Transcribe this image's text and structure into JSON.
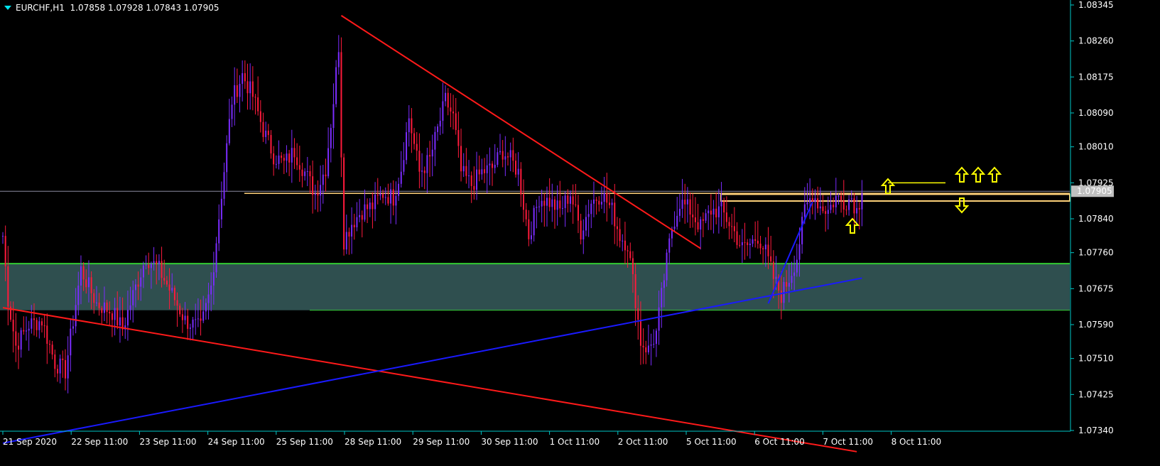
{
  "header": {
    "symbol": "EURCHF,H1",
    "ohlc": "1.07858 1.07928 1.07843 1.07905"
  },
  "colors": {
    "background": "#000000",
    "axis": "#00c8c8",
    "bull_candle": "#7b2cff",
    "bear_candle": "#ff1a3c",
    "trendline_red": "#ff1a1a",
    "trendline_blue": "#1a1aff",
    "support_zone": "#2f4f4f",
    "support_border": "#33cc33",
    "resistance_line": "#ffd27a",
    "arrow": "#ffff00",
    "price_label_bg": "#c0c0c0"
  },
  "chart_data": {
    "type": "candlestick",
    "symbol": "EURCHF",
    "timeframe": "H1",
    "current_price": "1.07905",
    "y_ticks": [
      "1.08345",
      "1.08260",
      "1.08175",
      "1.08090",
      "1.08010",
      "1.07925",
      "1.07840",
      "1.07760",
      "1.07675",
      "1.07590",
      "1.07510",
      "1.07425",
      "1.07340"
    ],
    "x_labels": [
      "21 Sep 2020",
      "22 Sep 11:00",
      "23 Sep 11:00",
      "24 Sep 11:00",
      "25 Sep 11:00",
      "28 Sep 11:00",
      "29 Sep 11:00",
      "30 Sep 11:00",
      "1 Oct 11:00",
      "2 Oct 11:00",
      "5 Oct 11:00",
      "6 Oct 11:00",
      "7 Oct 11:00",
      "8 Oct 11:00"
    ],
    "price_path": [
      [
        0,
        1.078
      ],
      [
        2,
        1.0765
      ],
      [
        5,
        1.0754
      ],
      [
        10,
        1.0759
      ],
      [
        15,
        1.076
      ],
      [
        20,
        1.075
      ],
      [
        24,
        1.0748
      ],
      [
        30,
        1.0772
      ],
      [
        36,
        1.0764
      ],
      [
        42,
        1.0762
      ],
      [
        46,
        1.0758
      ],
      [
        50,
        1.0766
      ],
      [
        55,
        1.0775
      ],
      [
        60,
        1.0772
      ],
      [
        66,
        1.0765
      ],
      [
        70,
        1.076
      ],
      [
        76,
        1.0758
      ],
      [
        80,
        1.0768
      ],
      [
        84,
        1.079
      ],
      [
        88,
        1.0812
      ],
      [
        92,
        1.0818
      ],
      [
        96,
        1.0813
      ],
      [
        100,
        1.0805
      ],
      [
        104,
        1.0799
      ],
      [
        108,
        1.0797
      ],
      [
        112,
        1.08
      ],
      [
        116,
        1.0795
      ],
      [
        120,
        1.079
      ],
      [
        124,
        1.0796
      ],
      [
        127,
        1.0812
      ],
      [
        129,
        1.0825
      ],
      [
        130,
        1.08
      ],
      [
        131,
        1.0779
      ],
      [
        134,
        1.0783
      ],
      [
        138,
        1.0786
      ],
      [
        142,
        1.0787
      ],
      [
        146,
        1.079
      ],
      [
        150,
        1.0789
      ],
      [
        153,
        1.0796
      ],
      [
        156,
        1.0808
      ],
      [
        160,
        1.0795
      ],
      [
        164,
        1.0798
      ],
      [
        167,
        1.0805
      ],
      [
        170,
        1.0812
      ],
      [
        173,
        1.0808
      ],
      [
        176,
        1.0795
      ],
      [
        180,
        1.0792
      ],
      [
        184,
        1.0795
      ],
      [
        188,
        1.0796
      ],
      [
        192,
        1.08
      ],
      [
        195,
        1.0798
      ],
      [
        198,
        1.0795
      ],
      [
        202,
        1.078
      ],
      [
        206,
        1.0789
      ],
      [
        210,
        1.0788
      ],
      [
        214,
        1.0786
      ],
      [
        218,
        1.079
      ],
      [
        222,
        1.0781
      ],
      [
        226,
        1.0788
      ],
      [
        230,
        1.079
      ],
      [
        234,
        1.0786
      ],
      [
        237,
        1.078
      ],
      [
        240,
        1.0778
      ],
      [
        243,
        1.0765
      ],
      [
        245,
        1.0755
      ],
      [
        248,
        1.0753
      ],
      [
        251,
        1.0757
      ],
      [
        254,
        1.077
      ],
      [
        257,
        1.0782
      ],
      [
        260,
        1.0788
      ],
      [
        264,
        1.0786
      ],
      [
        268,
        1.0782
      ],
      [
        272,
        1.0786
      ],
      [
        276,
        1.0786
      ],
      [
        280,
        1.0782
      ],
      [
        284,
        1.0777
      ],
      [
        287,
        1.0778
      ],
      [
        290,
        1.078
      ],
      [
        293,
        1.0776
      ],
      [
        296,
        1.077
      ],
      [
        299,
        1.0766
      ],
      [
        302,
        1.077
      ],
      [
        305,
        1.0775
      ],
      [
        308,
        1.0786
      ],
      [
        311,
        1.079
      ],
      [
        314,
        1.0787
      ],
      [
        317,
        1.0786
      ],
      [
        320,
        1.0789
      ],
      [
        323,
        1.0788
      ],
      [
        326,
        1.0789
      ],
      [
        328,
        1.0786
      ],
      [
        330,
        1.079
      ]
    ]
  },
  "annotations": {
    "red_trendline_a": [
      [
        130,
        1.0832
      ],
      [
        268,
        1.0777
      ]
    ],
    "red_trendline_b": [
      [
        0,
        1.0763
      ],
      [
        328,
        1.0729
      ]
    ],
    "blue_trendline_a": [
      [
        0,
        1.0731
      ],
      [
        330,
        1.077
      ]
    ],
    "blue_trendline_b": [
      [
        294,
        1.0764
      ],
      [
        311,
        1.0788
      ]
    ],
    "support_zone": [
      1.07624,
      1.07734
    ],
    "resistance_band": [
      1.07882,
      1.07898
    ],
    "upper_line": 1.07925,
    "long_line": 1.079,
    "up_arrows": [
      [
        1250,
        262
      ],
      [
        1200,
        318
      ],
      [
        1354,
        246
      ],
      [
        1377,
        246
      ],
      [
        1400,
        246
      ]
    ],
    "down_arrows": [
      [
        1354,
        289
      ]
    ]
  }
}
